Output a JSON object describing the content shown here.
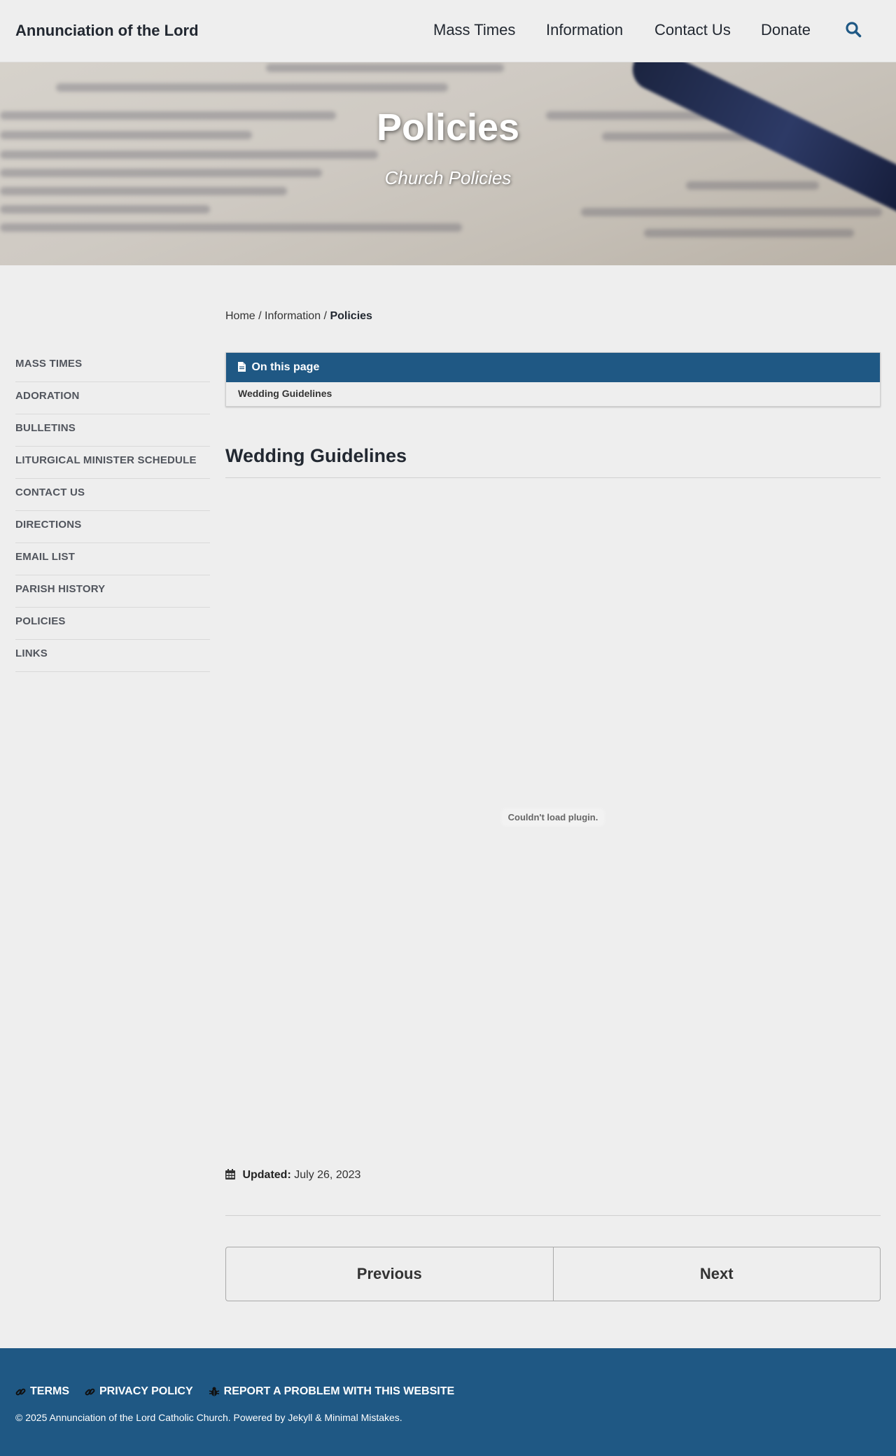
{
  "site": {
    "title": "Annunciation of the Lord"
  },
  "nav": {
    "items": [
      "Mass Times",
      "Information",
      "Contact Us",
      "Donate"
    ],
    "search_icon": "search-icon"
  },
  "hero": {
    "title": "Policies",
    "subtitle": "Church Policies"
  },
  "breadcrumb": {
    "home": "Home",
    "sep": "/",
    "section": "Information",
    "current": "Policies"
  },
  "sidebar": {
    "items": [
      "MASS TIMES",
      "ADORATION",
      "BULLETINS",
      "LITURGICAL MINISTER SCHEDULE",
      "CONTACT US",
      "DIRECTIONS",
      "EMAIL LIST",
      "PARISH HISTORY",
      "POLICIES",
      "LINKS"
    ]
  },
  "toc": {
    "header": "On this page",
    "icon": "file-icon",
    "items": [
      "Wedding Guidelines"
    ]
  },
  "content": {
    "heading": "Wedding Guidelines",
    "plugin_message": "Couldn't load plugin.",
    "updated_label": "Updated:",
    "updated_date": "July 26, 2023"
  },
  "pager": {
    "previous": "Previous",
    "next": "Next"
  },
  "footer": {
    "links": [
      "TERMS",
      "PRIVACY POLICY",
      "REPORT A PROBLEM WITH THIS WEBSITE"
    ],
    "copyright": "© 2025 Annunciation of the Lord Catholic Church. Powered by Jekyll & Minimal Mistakes."
  },
  "colors": {
    "brand": "#1f5884",
    "background": "#eeeeee",
    "text": "#222831"
  }
}
